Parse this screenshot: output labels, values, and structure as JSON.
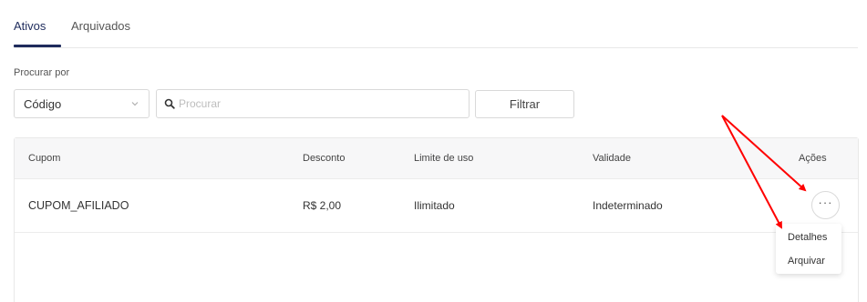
{
  "tabs": [
    {
      "label": "Ativos",
      "active": true
    },
    {
      "label": "Arquivados",
      "active": false
    }
  ],
  "search": {
    "label": "Procurar por",
    "field_value": "Código",
    "placeholder": "Procurar",
    "filter_button": "Filtrar"
  },
  "table": {
    "headers": [
      "Cupom",
      "Desconto",
      "Limite de uso",
      "Validade",
      "Ações"
    ],
    "rows": [
      {
        "cupom": "CUPOM_AFILIADO",
        "desconto": "R$ 2,00",
        "limite": "Ilimitado",
        "validade": "Indeterminado",
        "acoes": "···"
      }
    ]
  },
  "actions_menu": {
    "items": [
      "Detalhes",
      "Arquivar"
    ]
  },
  "colors": {
    "accent": "#1e2b5c",
    "annotation_arrow": "#ff0000"
  },
  "icons": [
    "chevron-down-icon",
    "search-icon",
    "more-horizontal-icon"
  ]
}
